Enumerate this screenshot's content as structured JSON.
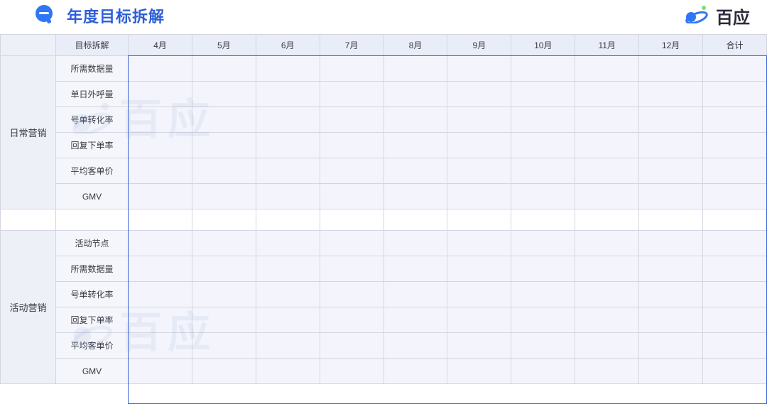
{
  "header": {
    "title": "年度目标拆解",
    "brand": "百应"
  },
  "table": {
    "corner1": "",
    "corner2": "目标拆解",
    "months": [
      "4月",
      "5月",
      "6月",
      "7月",
      "8月",
      "9月",
      "10月",
      "11月",
      "12月",
      "合计"
    ],
    "groups": [
      {
        "name": "日常营销",
        "metrics": [
          "所需数据量",
          "单日外呼量",
          "号单转化率",
          "回复下单率",
          "平均客单价",
          "GMV"
        ]
      },
      {
        "name": "活动营销",
        "metrics": [
          "活动节点",
          "所需数据量",
          "号单转化率",
          "回复下单率",
          "平均客单价",
          "GMV"
        ]
      }
    ]
  },
  "watermark_text": "百应"
}
